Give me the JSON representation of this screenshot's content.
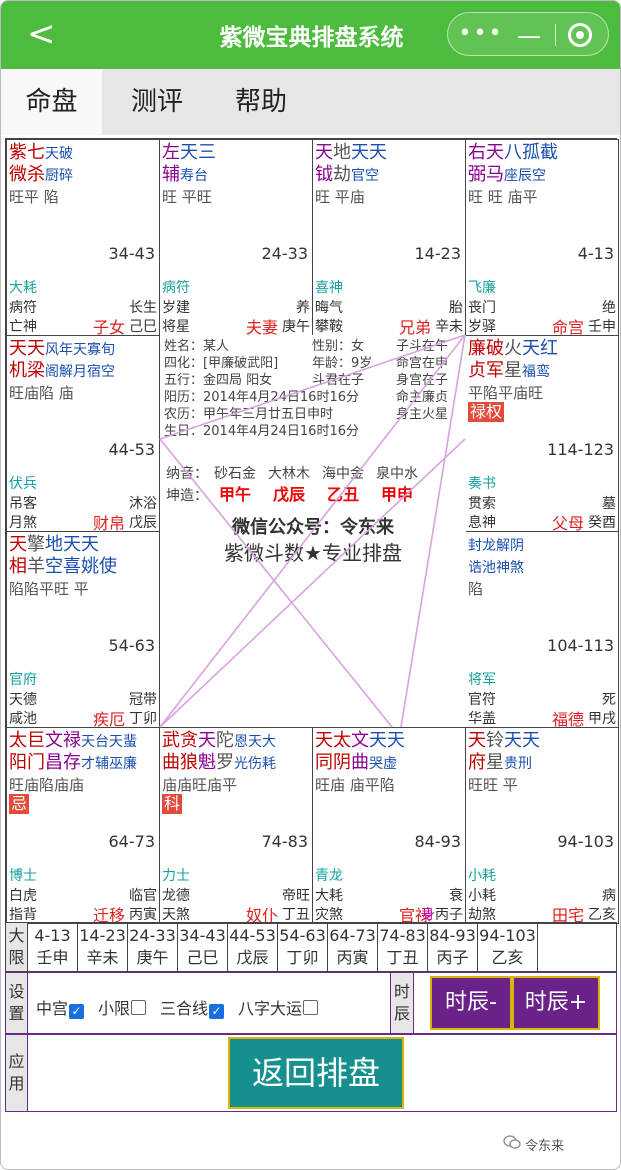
{
  "header": {
    "title": "紫微宝典排盘系统",
    "back": "<"
  },
  "tabs": [
    "命盘",
    "测评",
    "帮助"
  ],
  "palaces": [
    {
      "stars": [
        {
          "t": "紫七",
          "c": "m"
        },
        {
          "t": "天破",
          "c": "b s"
        }
      ],
      "stars2": [
        {
          "t": "微杀",
          "c": "m"
        },
        {
          "t": "厨碎",
          "c": "b s"
        }
      ],
      "bright": "旺平 陷",
      "range": "34-43",
      "boshi": "大耗",
      "s1": "病符",
      "s2": "长生",
      "s3": "亡神",
      "name": "子女",
      "gz": "己巳"
    },
    {
      "stars": [
        {
          "t": "左",
          "c": "p"
        },
        {
          "t": "天三",
          "c": "b"
        }
      ],
      "stars2": [
        {
          "t": "辅",
          "c": "p"
        },
        {
          "t": "寿台",
          "c": "b s"
        }
      ],
      "bright": "旺 平旺",
      "range": "24-33",
      "boshi": "病符",
      "s1": "岁建",
      "s2": "养",
      "s3": "将星",
      "name": "夫妻",
      "gz": "庚午"
    },
    {
      "stars": [
        {
          "t": "天",
          "c": "p"
        },
        {
          "t": "地",
          "c": "g"
        },
        {
          "t": "天天",
          "c": "b"
        }
      ],
      "stars2": [
        {
          "t": "钺",
          "c": "p"
        },
        {
          "t": "劫",
          "c": "g"
        },
        {
          "t": "官空",
          "c": "b s"
        }
      ],
      "bright": "旺 平庙",
      "range": "14-23",
      "boshi": "喜神",
      "s1": "晦气",
      "s2": "胎",
      "s3": "攀鞍",
      "name": "兄弟",
      "gz": "辛未"
    },
    {
      "stars": [
        {
          "t": "右天",
          "c": "p"
        },
        {
          "t": "八孤截",
          "c": "b"
        }
      ],
      "stars2": [
        {
          "t": "弼马",
          "c": "p"
        },
        {
          "t": "座辰空",
          "c": "b s"
        }
      ],
      "bright": "旺 旺 庙平",
      "range": "4-13",
      "boshi": "飞廉",
      "s1": "丧门",
      "s2": "绝",
      "s3": "岁驿",
      "name": "命宫",
      "gz": "壬申"
    },
    {
      "stars": [
        {
          "t": "天天",
          "c": "m"
        },
        {
          "t": "风年天寡旬",
          "c": "b s"
        }
      ],
      "stars2": [
        {
          "t": "机梁",
          "c": "m"
        },
        {
          "t": "阁解月宿空",
          "c": "b s"
        }
      ],
      "bright": "旺庙陷  庙",
      "range": "44-53",
      "boshi": "伏兵",
      "s1": "吊客",
      "s2": "沐浴",
      "s3": "月煞",
      "name": "财帛",
      "gz": "戊辰"
    },
    {
      "stars": [
        {
          "t": "廉破",
          "c": "m"
        },
        {
          "t": "火",
          "c": "g"
        },
        {
          "t": "天红",
          "c": "b"
        }
      ],
      "stars2": [
        {
          "t": "贞军",
          "c": "m"
        },
        {
          "t": "星",
          "c": "g"
        },
        {
          "t": "福鸾",
          "c": "b s"
        }
      ],
      "bright": "平陷平庙旺",
      "badge": "禄权",
      "range": "114-123",
      "boshi": "奏书",
      "s1": "贯索",
      "s2": "墓",
      "s3": "息神",
      "name": "父母",
      "gz": "癸酉"
    },
    {
      "stars": [
        {
          "t": "天",
          "c": "m"
        },
        {
          "t": "擎",
          "c": "g"
        },
        {
          "t": "地天天",
          "c": "b"
        }
      ],
      "stars2": [
        {
          "t": "相",
          "c": "m"
        },
        {
          "t": "羊",
          "c": "g"
        },
        {
          "t": "空喜姚使",
          "c": "b"
        }
      ],
      "bright": "陷陷平旺  平",
      "range": "54-63",
      "boshi": "官府",
      "s1": "天德",
      "s2": "冠带",
      "s3": "咸池",
      "name": "疾厄",
      "gz": "丁卯"
    },
    {
      "stars": [
        {
          "t": "封龙解阴",
          "c": "b s"
        }
      ],
      "stars2": [
        {
          "t": "诰池神煞",
          "c": "b s"
        }
      ],
      "bright": "  陷",
      "range": "104-113",
      "boshi": "将军",
      "s1": "官符",
      "s2": "死",
      "s3": "华盖",
      "name": "福德",
      "gz": "甲戌"
    },
    {
      "stars": [
        {
          "t": "太巨",
          "c": "m"
        },
        {
          "t": "文禄",
          "c": "p"
        },
        {
          "t": "天台天蜚",
          "c": "b s"
        }
      ],
      "stars2": [
        {
          "t": "阳门",
          "c": "m"
        },
        {
          "t": "昌存",
          "c": "p"
        },
        {
          "t": "才辅巫廉",
          "c": "b s"
        }
      ],
      "bright": "旺庙陷庙庙",
      "badge": "忌",
      "range": "64-73",
      "boshi": "博士",
      "s1": "白虎",
      "s2": "临官",
      "s3": "指背",
      "name": "迁移",
      "gz": "丙寅"
    },
    {
      "stars": [
        {
          "t": "武贪",
          "c": "m"
        },
        {
          "t": "天",
          "c": "p"
        },
        {
          "t": "陀",
          "c": "g"
        },
        {
          "t": "恩天大",
          "c": "b s"
        }
      ],
      "stars2": [
        {
          "t": "曲狼",
          "c": "m"
        },
        {
          "t": "魁",
          "c": "p"
        },
        {
          "t": "罗",
          "c": "g"
        },
        {
          "t": "光伤耗",
          "c": "b s"
        }
      ],
      "bright": "庙庙旺庙平",
      "badge": "科",
      "range": "74-83",
      "boshi": "力士",
      "s1": "龙德",
      "s2": "帝旺",
      "s3": "天煞",
      "name": "奴仆",
      "gz": "丁丑"
    },
    {
      "stars": [
        {
          "t": "天太",
          "c": "m"
        },
        {
          "t": "文",
          "c": "p"
        },
        {
          "t": "天天",
          "c": "b"
        }
      ],
      "stars2": [
        {
          "t": "同阴",
          "c": "m"
        },
        {
          "t": "曲",
          "c": "p"
        },
        {
          "t": "哭虚",
          "c": "b s"
        }
      ],
      "bright": "旺庙 庙平陷",
      "range": "84-93",
      "boshi": "青龙",
      "s1": "大耗",
      "s2": "衰",
      "s3": "灾煞",
      "name": "官禄",
      "gz": "丙子",
      "shen": "身"
    },
    {
      "stars": [
        {
          "t": "天",
          "c": "m"
        },
        {
          "t": "铃",
          "c": "g"
        },
        {
          "t": "天天",
          "c": "b"
        }
      ],
      "stars2": [
        {
          "t": "府",
          "c": "m"
        },
        {
          "t": "星",
          "c": "g"
        },
        {
          "t": "贵刑",
          "c": "b s"
        }
      ],
      "bright": "旺旺 平",
      "range": "94-103",
      "boshi": "小耗",
      "s1": "小耗",
      "s2": "病",
      "s3": "劫煞",
      "name": "田宅",
      "gz": "乙亥"
    }
  ],
  "center": {
    "rows": [
      {
        "a": "姓名：",
        "av": "某人",
        "b": "性别：",
        "bv": "女",
        "c": "子斗在午",
        "cc": "g"
      },
      {
        "a": "四化：",
        "av": "[甲廉破武阳]",
        "b": "年龄：",
        "bv": "9岁",
        "c": "命宫在申",
        "cc": "r"
      },
      {
        "a": "五行：",
        "av": "金四局 阳女",
        "b": "",
        "bv": "斗君在子",
        "c": "身宫在子",
        "cc": "r"
      },
      {
        "a": "阳历：",
        "av": "2014年4月24日16时16分",
        "b": "",
        "bv": "",
        "c": "命主廉贞",
        "cc": "gr"
      },
      {
        "a": "农历：",
        "av": "甲午年三月廿五日申时",
        "b": "",
        "bv": "",
        "c": "身主火星",
        "cc": "gr"
      },
      {
        "a": "生日：",
        "av": "2014年4月24日16时16分",
        "b": "",
        "bv": "",
        "c": "",
        "cc": "g"
      }
    ],
    "nayin_label": "纳音：",
    "nayin": [
      "砂石金",
      "大林木",
      "海中金",
      "泉中水"
    ],
    "qiankun_label": "坤造：",
    "bazi": [
      "甲午",
      "戊辰",
      "乙丑",
      "甲申"
    ],
    "wechat": "微信公众号：令东来",
    "slogan": "紫微斗数★专业排盘"
  },
  "daxian": {
    "head": "大限",
    "cells": [
      {
        "r": "4-13",
        "g": "壬申"
      },
      {
        "r": "14-23",
        "g": "辛未"
      },
      {
        "r": "24-33",
        "g": "庚午"
      },
      {
        "r": "34-43",
        "g": "己巳"
      },
      {
        "r": "44-53",
        "g": "戊辰"
      },
      {
        "r": "54-63",
        "g": "丁卯"
      },
      {
        "r": "64-73",
        "g": "丙寅"
      },
      {
        "r": "74-83",
        "g": "丁丑"
      },
      {
        "r": "84-93",
        "g": "丙子"
      },
      {
        "r": "94-103",
        "g": "乙亥"
      }
    ]
  },
  "settings": {
    "head": "设置",
    "options": [
      {
        "label": "中宫",
        "checked": true
      },
      {
        "label": "小限",
        "checked": false
      },
      {
        "label": "三合线",
        "checked": true
      },
      {
        "label": "八字大运",
        "checked": false
      }
    ],
    "shichen_head": "时辰",
    "prev": "时辰-",
    "next": "时辰+"
  },
  "apply": {
    "head": "应用",
    "button": "返回排盘"
  },
  "footer": {
    "brand": "令东来"
  }
}
